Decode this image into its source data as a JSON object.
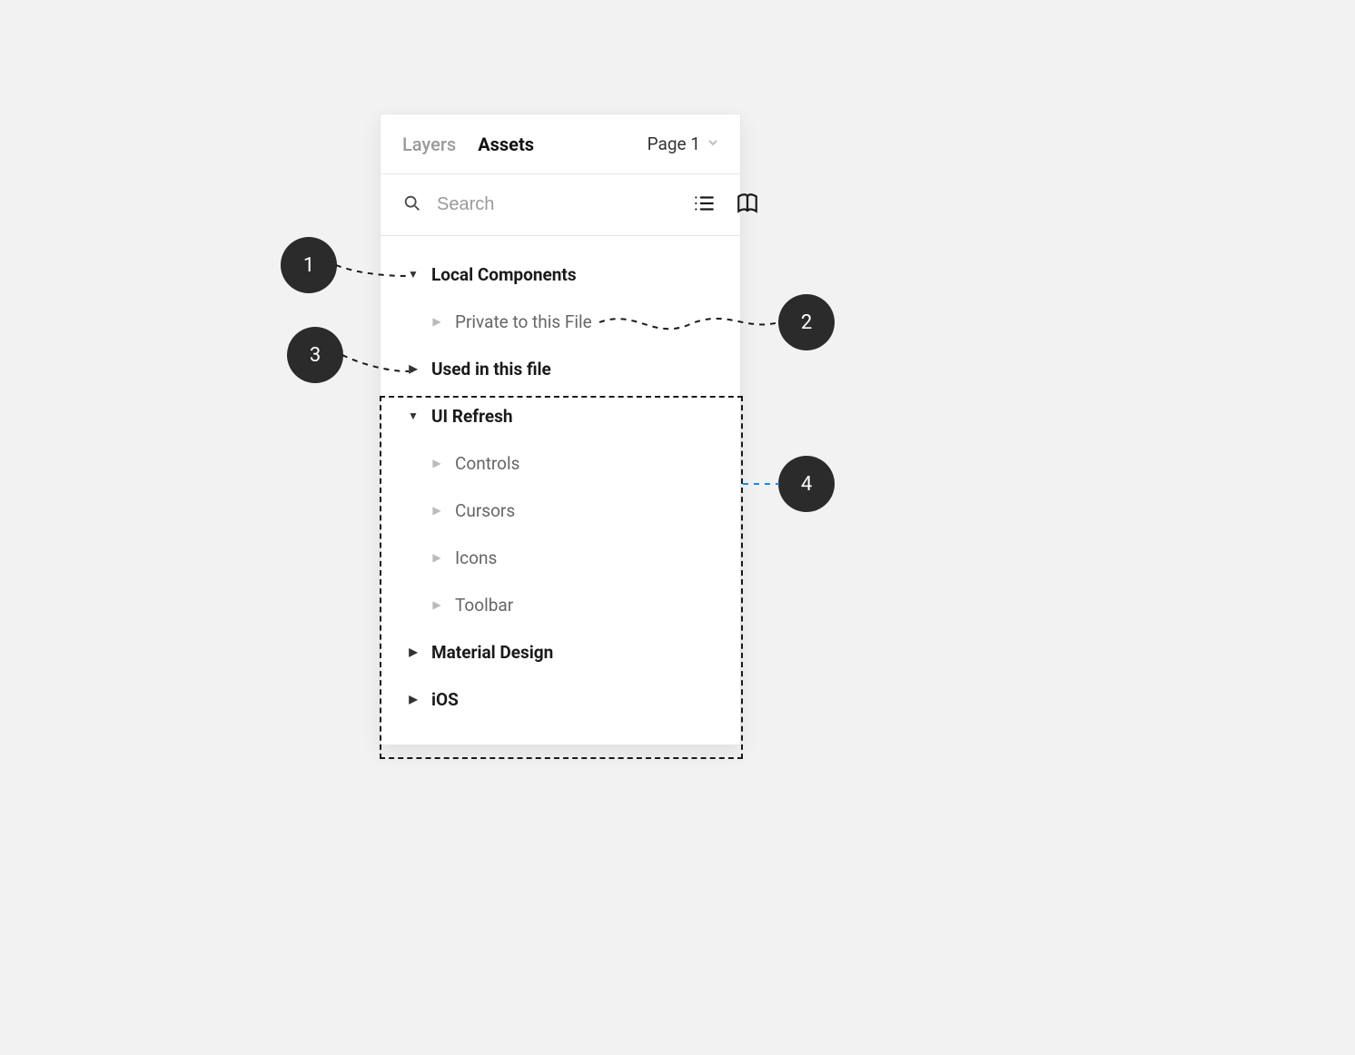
{
  "tabs": {
    "layers": "Layers",
    "assets": "Assets"
  },
  "pageSelector": "Page 1",
  "search": {
    "placeholder": "Search"
  },
  "tree": {
    "local_components": "Local Components",
    "private_to_file": "Private to this File",
    "used_in_file": "Used in this file",
    "ui_refresh": "UI Refresh",
    "controls": "Controls",
    "cursors": "Cursors",
    "icons": "Icons",
    "toolbar": "Toolbar",
    "material_design": "Material Design",
    "ios": "iOS"
  },
  "callouts": {
    "c1": "1",
    "c2": "2",
    "c3": "3",
    "c4": "4"
  }
}
